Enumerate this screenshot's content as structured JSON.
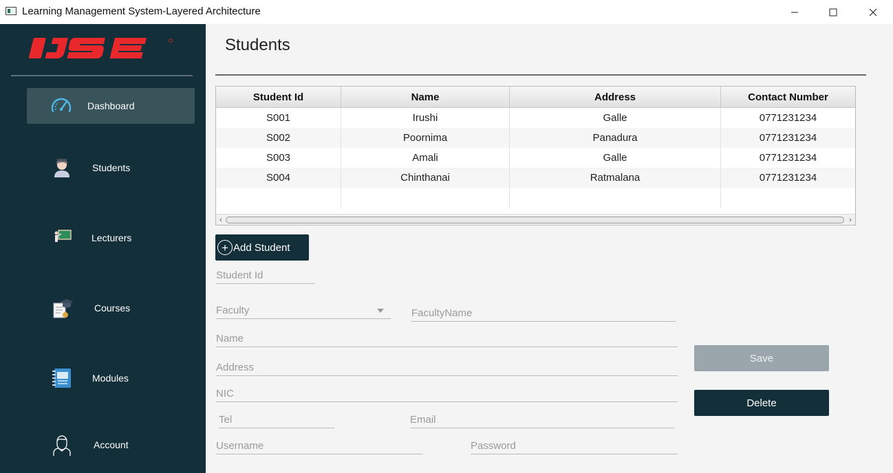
{
  "window": {
    "title": "Learning Management System-Layered Architecture",
    "minimize_glyph": "—",
    "maximize_glyph": "☐",
    "close_glyph": "✕"
  },
  "sidebar": {
    "logo_text": "IJSE",
    "items": [
      {
        "label": "Dashboard",
        "icon": "speedometer-icon",
        "active": true
      },
      {
        "label": "Students",
        "icon": "student-icon"
      },
      {
        "label": "Lecturers",
        "icon": "lecturer-board-icon"
      },
      {
        "label": "Courses",
        "icon": "graduation-certificate-icon"
      },
      {
        "label": "Modules",
        "icon": "notebook-icon"
      },
      {
        "label": "Account",
        "icon": "user-outline-icon"
      }
    ]
  },
  "main": {
    "title": "Students",
    "table": {
      "columns": [
        "Student Id",
        "Name",
        "Address",
        "Contact Number"
      ],
      "rows": [
        [
          "S001",
          "Irushi",
          "Galle",
          "0771231234"
        ],
        [
          "S002",
          "Poornima",
          "Panadura",
          "0771231234"
        ],
        [
          "S003",
          "Amali",
          "Galle",
          "0771231234"
        ],
        [
          "S004",
          "Chinthanai",
          "Ratmalana",
          "0771231234"
        ]
      ]
    },
    "add_button": {
      "label": "Add Student",
      "icon": "plus-circle-icon"
    },
    "form": {
      "student_id_placeholder": "Student Id",
      "faculty_placeholder": "Faculty",
      "faculty_name_placeholder": "FacultyName",
      "name_placeholder": "Name",
      "address_placeholder": "Address",
      "nic_placeholder": "NIC",
      "tel_placeholder": "Tel",
      "email_placeholder": "Email",
      "username_placeholder": "Username",
      "password_placeholder": "Password"
    },
    "save_label": "Save",
    "delete_label": "Delete"
  },
  "colors": {
    "sidebar_bg": "#13303a",
    "active_item_bg": "#385359",
    "logo_red": "#e8282b",
    "save_disabled": "#9aa6ab",
    "delete_bg": "#13303a"
  }
}
